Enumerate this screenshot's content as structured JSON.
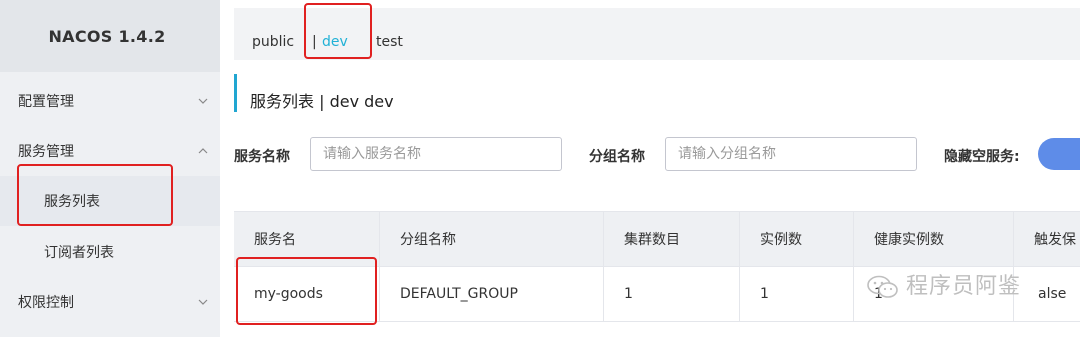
{
  "sidebar": {
    "brand": "NACOS 1.4.2",
    "items": [
      {
        "label": "配置管理",
        "state": "collapsed"
      },
      {
        "label": "服务管理",
        "state": "expanded"
      },
      {
        "label": "服务列表",
        "state": "active"
      },
      {
        "label": "订阅者列表"
      },
      {
        "label": "权限控制",
        "state": "collapsed"
      }
    ]
  },
  "namespaces": {
    "items": [
      "public",
      "dev",
      "test"
    ],
    "separator": "|",
    "selected": "dev"
  },
  "page": {
    "title": "服务列表 | dev dev"
  },
  "filters": {
    "service_name_label": "服务名称",
    "service_name_placeholder": "请输入服务名称",
    "group_name_label": "分组名称",
    "group_name_placeholder": "请输入分组名称",
    "hide_empty_label": "隐藏空服务:"
  },
  "table": {
    "columns": [
      "服务名",
      "分组名称",
      "集群数目",
      "实例数",
      "健康实例数",
      "触发保"
    ],
    "rows": [
      [
        "my-goods",
        "DEFAULT_GROUP",
        "1",
        "1",
        "1",
        "alse"
      ]
    ]
  },
  "watermark": "程序员阿鉴",
  "colors": {
    "accent": "#21b1d6",
    "highlight_box": "#e02020",
    "toggle": "#5e8ce8"
  }
}
